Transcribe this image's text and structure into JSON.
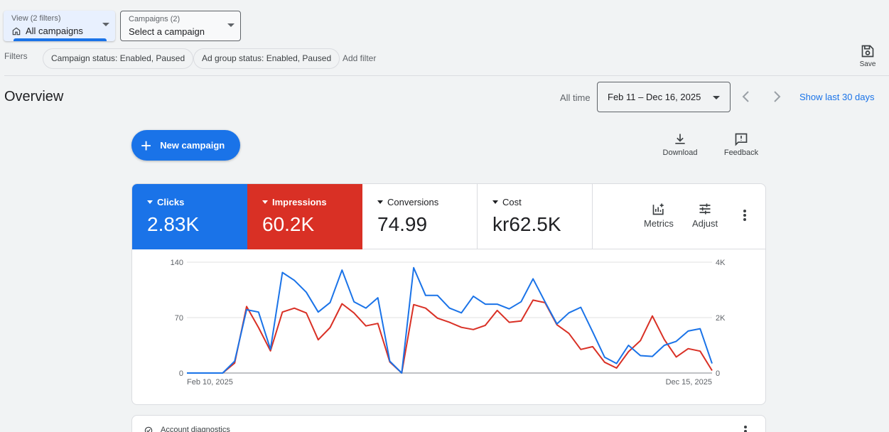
{
  "view_selector": {
    "sub": "View (2 filters)",
    "value": "All campaigns"
  },
  "campaign_selector": {
    "sub": "Campaigns (2)",
    "value": "Select a campaign"
  },
  "filters": {
    "label": "Filters",
    "chips": [
      "Campaign status: Enabled, Paused",
      "Ad group status: Enabled, Paused"
    ],
    "add_filter": "Add filter"
  },
  "save_label": "Save",
  "overview": {
    "title": "Overview",
    "all_time": "All time",
    "date_range": "Feb 11 – Dec 16, 2025",
    "show_last": "Show last 30 days"
  },
  "new_campaign_label": "New campaign",
  "toolbar": {
    "download": "Download",
    "feedback": "Feedback"
  },
  "metrics": [
    {
      "label": "Clicks",
      "value": "2.83K",
      "color": "#1a73e8"
    },
    {
      "label": "Impressions",
      "value": "60.2K",
      "color": "#d93025"
    },
    {
      "label": "Conversions",
      "value": "74.99"
    },
    {
      "label": "Cost",
      "value": "kr62.5K"
    }
  ],
  "metric_tools": {
    "metrics": "Metrics",
    "adjust": "Adjust"
  },
  "bottom_card_title": "Account diagnostics",
  "chart_data": {
    "type": "line",
    "x_start_label": "Feb 10, 2025",
    "x_end_label": "Dec 15, 2025",
    "left_axis": {
      "ticks": [
        "0",
        "70",
        "140"
      ],
      "ylim": [
        0,
        140
      ]
    },
    "right_axis": {
      "ticks": [
        "0",
        "2K",
        "4K"
      ],
      "ylim": [
        0,
        4000
      ]
    },
    "grid": true,
    "series": [
      {
        "name": "Clicks",
        "axis": "left",
        "color": "#1a73e8",
        "values": [
          0,
          0,
          0,
          0,
          15,
          80,
          77,
          30,
          127,
          117,
          102,
          77,
          89,
          130,
          90,
          82,
          95,
          15,
          0,
          133,
          98,
          98,
          82,
          76,
          97,
          87,
          87,
          81,
          90,
          119,
          90,
          62,
          76,
          83,
          52,
          20,
          12,
          35,
          22,
          21,
          35,
          40,
          53,
          56,
          12
        ]
      },
      {
        "name": "Impressions",
        "axis": "right",
        "color": "#d93025",
        "values": [
          0,
          0,
          0,
          0,
          360,
          2400,
          1640,
          800,
          2200,
          2340,
          2170,
          1200,
          1640,
          2500,
          2170,
          1700,
          1790,
          400,
          0,
          2470,
          2340,
          1980,
          1830,
          1650,
          1570,
          1720,
          2260,
          1830,
          1880,
          2630,
          2540,
          1740,
          1430,
          850,
          950,
          390,
          180,
          770,
          1170,
          2060,
          1210,
          580,
          880,
          790,
          90
        ]
      }
    ]
  }
}
